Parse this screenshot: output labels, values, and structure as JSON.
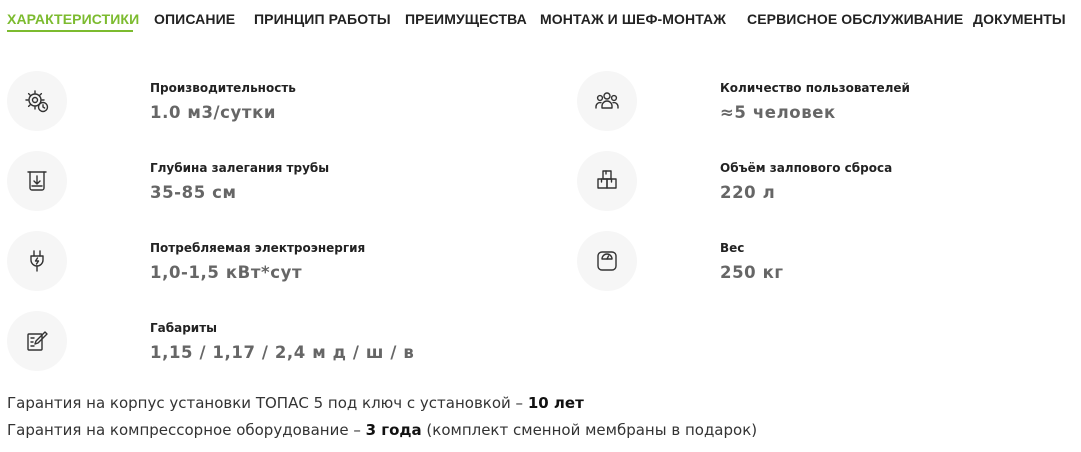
{
  "tabs": [
    {
      "label": "ХАРАКТЕРИСТИКИ",
      "active": true
    },
    {
      "label": "ОПИСАНИЕ"
    },
    {
      "label": "ПРИНЦИП РАБОТЫ"
    },
    {
      "label": "ПРЕИМУЩЕСТВА"
    },
    {
      "label": "МОНТАЖ И ШЕФ-МОНТАЖ"
    },
    {
      "label": "СЕРВИСНОЕ ОБСЛУЖИВАНИЕ"
    },
    {
      "label": "ДОКУМЕНТЫ"
    }
  ],
  "accent_color": "#7cbb2f",
  "specs": {
    "left": [
      {
        "icon": "gear-clock-icon",
        "label": "Производительность",
        "value": "1.0 м3/сутки"
      },
      {
        "icon": "pipe-depth-icon",
        "label": "Глубина залегания трубы",
        "value": "35-85 см"
      },
      {
        "icon": "power-plug-icon",
        "label": "Потребляемая электроэнергия",
        "value": "1,0-1,5 кВт*сут"
      },
      {
        "icon": "pencil-ruler-icon",
        "label": "Габариты",
        "value": "1,15 / 1,17 / 2,4 м д / ш / в"
      }
    ],
    "right": [
      {
        "icon": "users-icon",
        "label": "Количество пользователей",
        "value": "≈5 человек"
      },
      {
        "icon": "boxes-icon",
        "label": "Объём залпового сброса",
        "value": "220 л"
      },
      {
        "icon": "scale-icon",
        "label": "Вес",
        "value": "250 кг"
      }
    ]
  },
  "warranty": {
    "body_text": "Гарантия на корпус установки ТОПАС 5 под ключ с установкой – ",
    "body_value": "10 лет",
    "compressor_text": "Гарантия на компрессорное оборудование – ",
    "compressor_value": "3 года",
    "compressor_note": " (комплект сменной мембраны в подарок)"
  }
}
